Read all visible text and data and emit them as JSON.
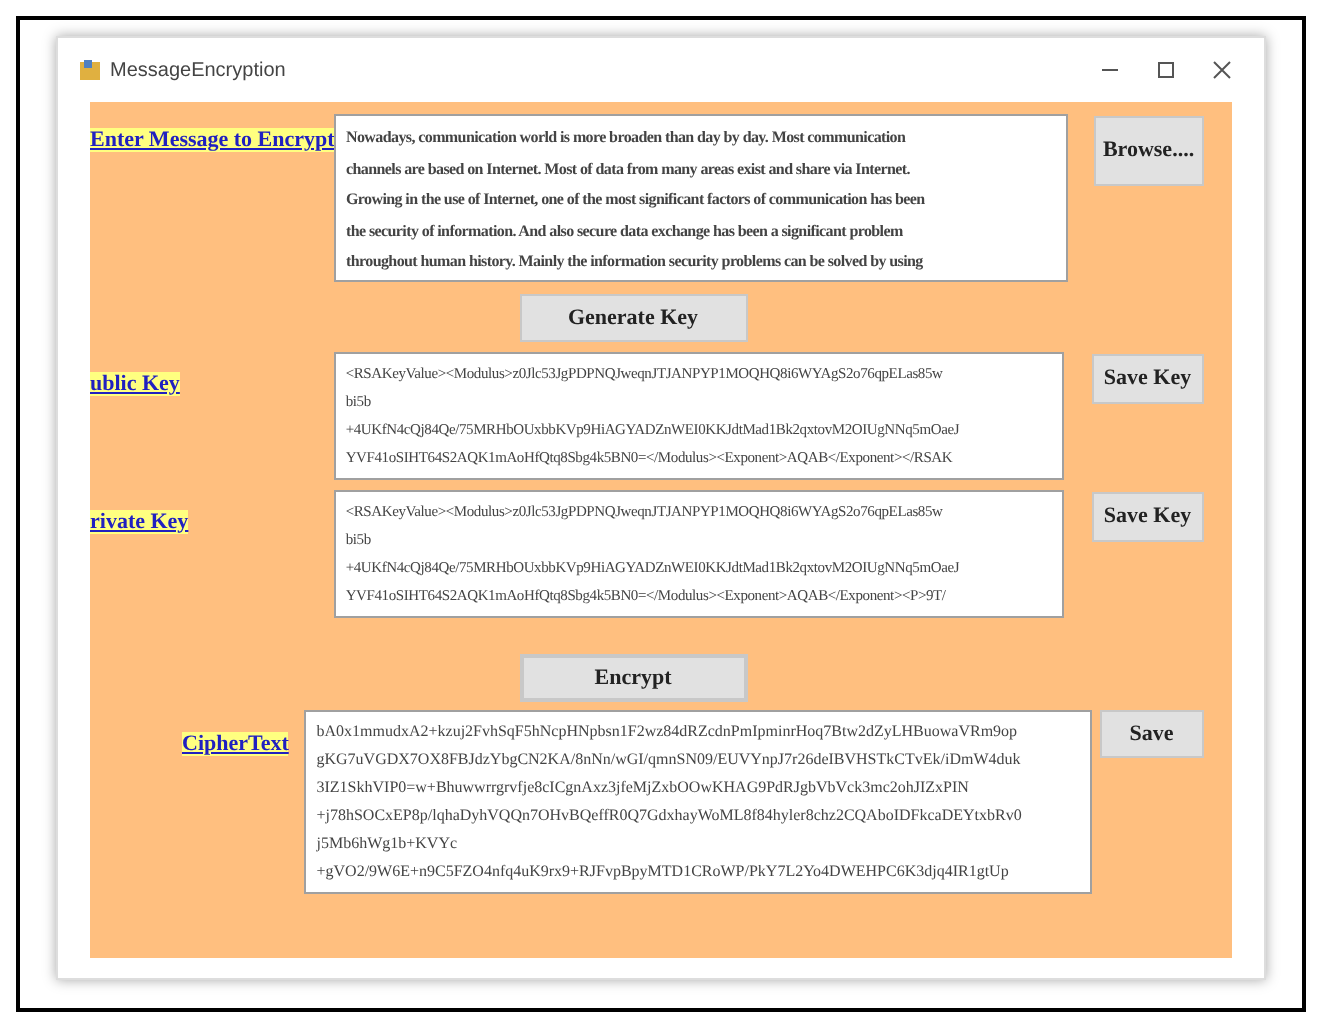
{
  "window": {
    "title": "MessageEncryption"
  },
  "message": {
    "label": "Enter Message to Encrypt",
    "value": "Nowadays, communication world is more broaden than day by day. Most communication\nchannels are based on Internet. Most of data from many areas exist and share via Internet.\nGrowing in the use of Internet, one of the most significant factors of communication has been\nthe security of information. And also secure data exchange has been a significant problem\nthroughout human history. Mainly the information security problems can be solved by using",
    "button": "Browse...."
  },
  "generate_button": "Generate Key",
  "keys": [
    {
      "label": "ublic Key",
      "value": "<RSAKeyValue><Modulus>z0Jlc53JgPDPNQJweqnJTJANPYP1MOQHQ8i6WYAgS2o76qpELas85w\nbi5b\n+4UKfN4cQj84Qe/75MRHbOUxbbKVp9HiAGYADZnWEI0KKJdtMad1Bk2qxtovM2OIUgNNq5mOaeJ\nYVF41oSIHT64S2AQK1mAoHfQtq8Sbg4k5BN0=</Modulus><Exponent>AQAB</Exponent></RSAK",
      "button": "Save Key"
    },
    {
      "label": "rivate Key",
      "value": "<RSAKeyValue><Modulus>z0Jlc53JgPDPNQJweqnJTJANPYP1MOQHQ8i6WYAgS2o76qpELas85w\nbi5b\n+4UKfN4cQj84Qe/75MRHbOUxbbKVp9HiAGYADZnWEI0KKJdtMad1Bk2qxtovM2OIUgNNq5mOaeJ\nYVF41oSIHT64S2AQK1mAoHfQtq8Sbg4k5BN0=</Modulus><Exponent>AQAB</Exponent><P>9T/",
      "button": "Save Key"
    }
  ],
  "encrypt_button": "Encrypt",
  "cipher": {
    "label": "CipherText",
    "value": "bA0x1mmudxA2+kzuj2FvhSqF5hNcpHNpbsn1F2wz84dRZcdnPmIpminrHoq7Btw2dZyLHBuowaVRm9op\ngKG7uVGDX7OX8FBJdzYbgCN2KA/8nNn/wGI/qmnSN09/EUVYnpJ7r26deIBVHSTkCTvEk/iDmW4duk\n3IZ1SkhVIP0=w+Bhuwwrrgrvfje8cICgnAxz3jfeMjZxbOOwKHAG9PdRJgbVbVck3mc2ohJIZxPIN\n+j78hSOCxEP8p/lqhaDyhVQQn7OHvBQeffR0Q7GdxhayWoML8f84hyler8chz2CQAboIDFkcaDEYtxbRv0\nj5Mb6hWg1b+KVYc\n+gVO2/9W6E+n9C5FZO4nfq4uK9rx9+RJFvpBpyMTD1CRoWP/PkY7L2Yo4DWEHPC6K3djq4IR1gtUp",
    "button": "Save"
  }
}
